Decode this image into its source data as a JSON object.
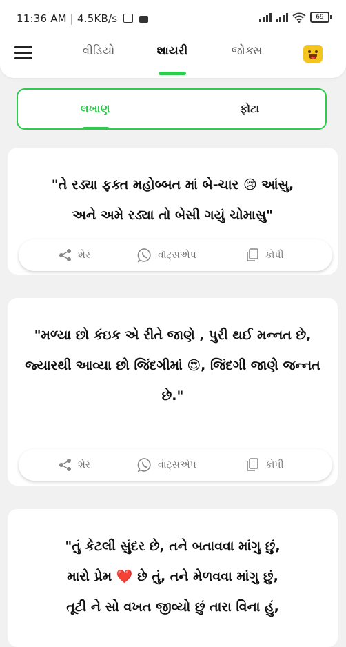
{
  "status_bar": {
    "time_speed": "11:36 AM | 4.5KB/s",
    "battery": "69"
  },
  "nav": {
    "tabs": [
      {
        "label": "વીડિયો"
      },
      {
        "label": "શાયરી"
      },
      {
        "label": "જોક્સ"
      }
    ],
    "active_tab": "શાયરી",
    "accent_color": "#2fcb4d"
  },
  "sub_tabs": [
    {
      "label": "લખાણ"
    },
    {
      "label": "ફોટા"
    }
  ],
  "actions": {
    "share": "શેર",
    "whatsapp": "વૉટ્સએપ",
    "copy": "કોપી"
  },
  "posts": [
    {
      "lines": [
        "\"તે રડ્યા ફક્ત મહોબ્બત માં બે-ચાર 😢 આંસુ,",
        "અને અમે રડ્યા તો બેસી ગયું ચોમાસુ\""
      ]
    },
    {
      "lines": [
        "\"મળ્યા છો કંઇક એ રીતે જાણે , પુરી થઈ મન્નત છે,",
        "જ્યારથી આવ્યા છો જિંદગીમાં 😍, જિંદગી જાણે જન્નત છે.\""
      ]
    },
    {
      "lines": [
        "\"તું કેટલી સુંદર છે, તને બતાવવા માંગુ છું,",
        "મારો પ્રેમ ❤️ છે તું, તને મેળવવા માંગુ છું,",
        "તૂટી ને સો વખત જીવ્યો છું તારા વિના હું,"
      ]
    }
  ]
}
